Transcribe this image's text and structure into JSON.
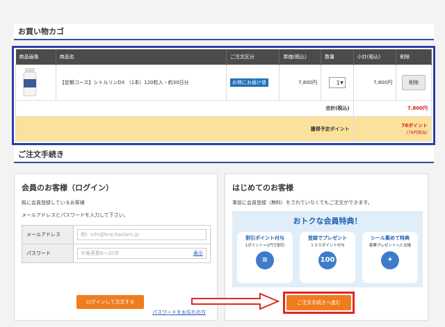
{
  "cart": {
    "title": "お買い物カゴ",
    "headers": [
      "商品画像",
      "商品名",
      "ご注文区分",
      "単価(税込)",
      "数量",
      "小計(税込)",
      "削除"
    ],
    "item": {
      "name": "【定期コース】シトルリンDX （1本）120粒入・約30日分",
      "order_type": "お得にお届け便",
      "unit_price": "7,800円",
      "qty": "1",
      "subtotal": "7,800円",
      "delete": "削除"
    },
    "total_label": "合計(税込)",
    "total_value": "7,800円",
    "point_label": "獲得予定ポイント",
    "point_value": "78ポイント",
    "point_sub": "(78円相当)"
  },
  "procedure": {
    "title": "ご注文手続き"
  },
  "login": {
    "title": "会員のお客様（ログイン）",
    "desc1": "既に会員登録しているお客様",
    "desc2": "メールアドレスとパスワードを入力して下さい。",
    "email_label": "メールアドレス",
    "email_placeholder": "例）info@krachaidam.jp",
    "password_label": "パスワード",
    "password_placeholder": "半角英数6～20字",
    "show": "表示",
    "login_button": "ログインして注文する",
    "forgot": "パスワードをお忘れの方"
  },
  "guest": {
    "title": "はじめてのお客様",
    "desc": "事前に会員登録（無料）をされていなくてもご注文ができます。",
    "benefit_title": "おトクな会員特典！",
    "cards": [
      {
        "title": "割引ポイント付与",
        "sub": "1ポイント＝1円で割引",
        "badge": "≡"
      },
      {
        "title": "登録でプレゼント",
        "sub": "１００ポイント付与",
        "badge": "100"
      },
      {
        "title": "シール集めて特典",
        "sub": "豪華プレゼントへと交換",
        "badge": "✦"
      }
    ],
    "proceed_button": "ご注文手続きへ進む"
  }
}
